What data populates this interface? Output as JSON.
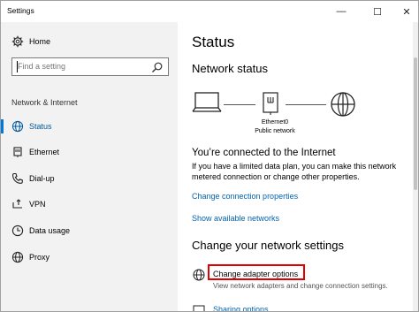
{
  "window": {
    "title": "Settings",
    "minimize_glyph": "—",
    "maximize_glyph": "☐",
    "close_glyph": "✕"
  },
  "sidebar": {
    "home_label": "Home",
    "search_placeholder": "Find a setting",
    "section_label": "Network & Internet",
    "items": [
      {
        "label": "Status",
        "icon": "globe-icon",
        "active": true
      },
      {
        "label": "Ethernet",
        "icon": "ethernet-icon",
        "active": false
      },
      {
        "label": "Dial-up",
        "icon": "phone-icon",
        "active": false
      },
      {
        "label": "VPN",
        "icon": "vpn-icon",
        "active": false
      },
      {
        "label": "Data usage",
        "icon": "clock-icon",
        "active": false
      },
      {
        "label": "Proxy",
        "icon": "proxy-globe-icon",
        "active": false
      }
    ]
  },
  "main": {
    "title": "Status",
    "network_status_heading": "Network status",
    "adapter_name": "Ethernet0",
    "network_type": "Public network",
    "connected_heading": "You’re connected to the Internet",
    "connected_text": "If you have a limited data plan, you can make this network metered connection or change other properties.",
    "change_connection_link": "Change connection properties",
    "show_networks_link": "Show available networks",
    "change_settings_heading": "Change your network settings",
    "adapter_options_label": "Change adapter options",
    "adapter_options_desc": "View network adapters and change connection settings.",
    "sharing_options_label": "Sharing options"
  },
  "colors": {
    "accent": "#0078d7",
    "link": "#0063b1",
    "highlight": "#e00000",
    "sidebar_bg": "#f2f2f2"
  }
}
